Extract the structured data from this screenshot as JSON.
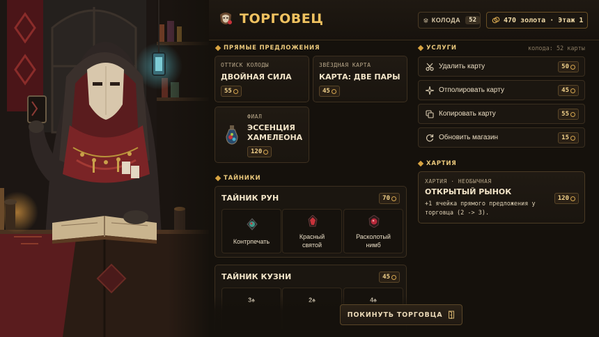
{
  "header": {
    "title": "ТОРГОВЕЦ",
    "deck_label": "КОЛОДА",
    "deck_count": "52",
    "gold_text": "470 золота · Этаж 1"
  },
  "sections": {
    "direct_offers": "ПРЯМЫЕ ПРЕДЛОЖЕНИЯ",
    "services": "УСЛУГИ",
    "services_meta": "колода: 52 карты",
    "stashes": "ТАЙНИКИ",
    "charter": "ХАРТИЯ"
  },
  "offers": [
    {
      "kicker": "ОТТИСК КОЛОДЫ",
      "name": "ДВОЙНАЯ СИЛА",
      "price": "55"
    },
    {
      "kicker": "ЗВЁЗДНАЯ КАРТА",
      "name": "КАРТА: ДВЕ ПАРЫ",
      "price": "45"
    },
    {
      "kicker": "ФИАЛ",
      "name_line1": "ЭССЕНЦИЯ",
      "name_line2": "ХАМЕЛЕОНА",
      "price": "120"
    }
  ],
  "services": [
    {
      "label": "Удалить карту",
      "price": "50",
      "icon": "scissors-icon"
    },
    {
      "label": "Отполировать карту",
      "price": "45",
      "icon": "sparkle-icon"
    },
    {
      "label": "Копировать карту",
      "price": "55",
      "icon": "copy-icon"
    },
    {
      "label": "Обновить магазин",
      "price": "15",
      "icon": "refresh-icon"
    }
  ],
  "charter": {
    "kicker": "ХАРТИЯ · НЕОБЫЧНАЯ",
    "name": "ОТКРЫТЫЙ РЫНОК",
    "desc_line1": "+1 ячейка прямого предложения у",
    "desc_line2": "торговца (2 -> 3).",
    "price": "120"
  },
  "stashes": [
    {
      "title": "ТАЙНИК РУН",
      "price": "70",
      "items": [
        {
          "label": "Контрпечать",
          "gem_color": "#3e9a8a"
        },
        {
          "label_line1": "Красный",
          "label_line2": "святой",
          "gem_color": "#c8323a"
        },
        {
          "label_line1": "Расколотый",
          "label_line2": "нимб",
          "gem_color": "#b8283a"
        }
      ]
    },
    {
      "title": "ТАЙНИК КУЗНИ",
      "price": "45",
      "items": [
        {
          "label": "3♠"
        },
        {
          "label": "2♠"
        },
        {
          "label": "4♠"
        }
      ]
    }
  ],
  "leave_button": "ПОКИНУТЬ ТОРГОВЦА",
  "colors": {
    "accent_gold": "#f0c260",
    "panel_bg": "#1b1610",
    "border": "#3d3020",
    "price_text": "#f1d18a"
  }
}
